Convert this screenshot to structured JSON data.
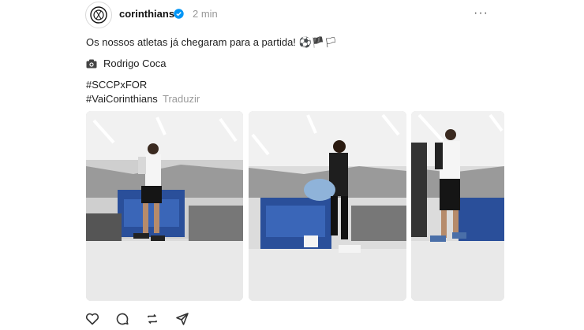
{
  "post": {
    "username": "corinthians",
    "time": "2 min",
    "caption": "Os nossos atletas já chegaram para a partida! ⚽🏴🏳",
    "photo_credit": "Rodrigo Coca",
    "hashtag_1": "#SCCPxFOR",
    "hashtag_2": "#VaiCorinthians",
    "translate_label": "Traduzir"
  },
  "colors": {
    "verified": "#0095f6",
    "muted": "#999999"
  },
  "icons": [
    "avatar-logo",
    "verified-badge-icon",
    "more-options-icon",
    "camera-icon",
    "heart-icon",
    "comment-icon",
    "repost-icon",
    "share-icon"
  ]
}
